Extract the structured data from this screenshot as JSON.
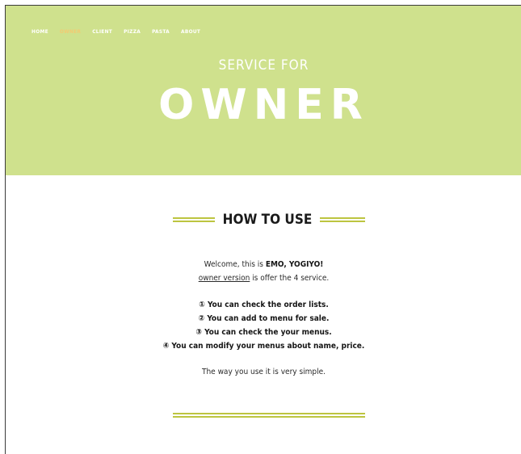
{
  "nav": {
    "items": [
      {
        "label": "HOME",
        "active": false
      },
      {
        "label": "OWNER",
        "active": true
      },
      {
        "label": "CLIENT",
        "active": false
      },
      {
        "label": "PIZZA",
        "active": false
      },
      {
        "label": "PASTA",
        "active": false
      },
      {
        "label": "ABOUT",
        "active": false
      }
    ]
  },
  "hero": {
    "subtitle": "SERVICE FOR",
    "title": "OWNER",
    "background_color": "#cfe18d",
    "active_nav_color": "#f3ca72"
  },
  "how_to_use": {
    "title": "HOW TO USE",
    "rule_color": "#bdc540",
    "welcome_prefix": "Welcome, this is ",
    "app_name": "EMO, YOGIYO!",
    "version_link": "owner version",
    "version_suffix": " is offer the 4 service.",
    "services": [
      "① You can check the order lists.",
      "② You can add to menu for sale.",
      "③ You can check the your menus.",
      "④ You can modify your menus about name, price."
    ],
    "closing": "The way you use it is very simple."
  }
}
